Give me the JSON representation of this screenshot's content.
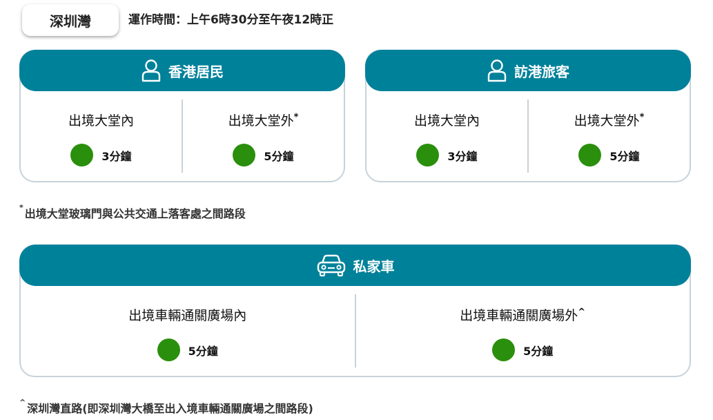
{
  "location": {
    "name": "深圳灣",
    "hours": "運作時間：上午6時30分至午夜12時正"
  },
  "colors": {
    "header": "#00819a",
    "status_ok": "#2a8f0c",
    "border": "#c7d2da"
  },
  "resident": {
    "title": "香港居民",
    "icon": "person-icon",
    "inside": {
      "label": "出境大堂內",
      "wait": "3分鐘"
    },
    "outside": {
      "label": "出境大堂外",
      "mark": "*",
      "wait": "5分鐘"
    }
  },
  "visitor": {
    "title": "訪港旅客",
    "icon": "person-icon",
    "inside": {
      "label": "出境大堂內",
      "wait": "3分鐘"
    },
    "outside": {
      "label": "出境大堂外",
      "mark": "*",
      "wait": "5分鐘"
    }
  },
  "note1": {
    "mark": "*",
    "text": "出境大堂玻璃門與公共交通上落客處之間路段"
  },
  "car": {
    "title": "私家車",
    "icon": "car-icon",
    "inside": {
      "label": "出境車輛通關廣場內",
      "wait": "5分鐘"
    },
    "outside": {
      "label": "出境車輛通關廣場外",
      "mark": "^",
      "wait": "5分鐘"
    }
  },
  "note2": {
    "mark": "^",
    "text": "深圳灣直路(即深圳灣大橋至出入境車輛通關廣場之間路段)"
  }
}
